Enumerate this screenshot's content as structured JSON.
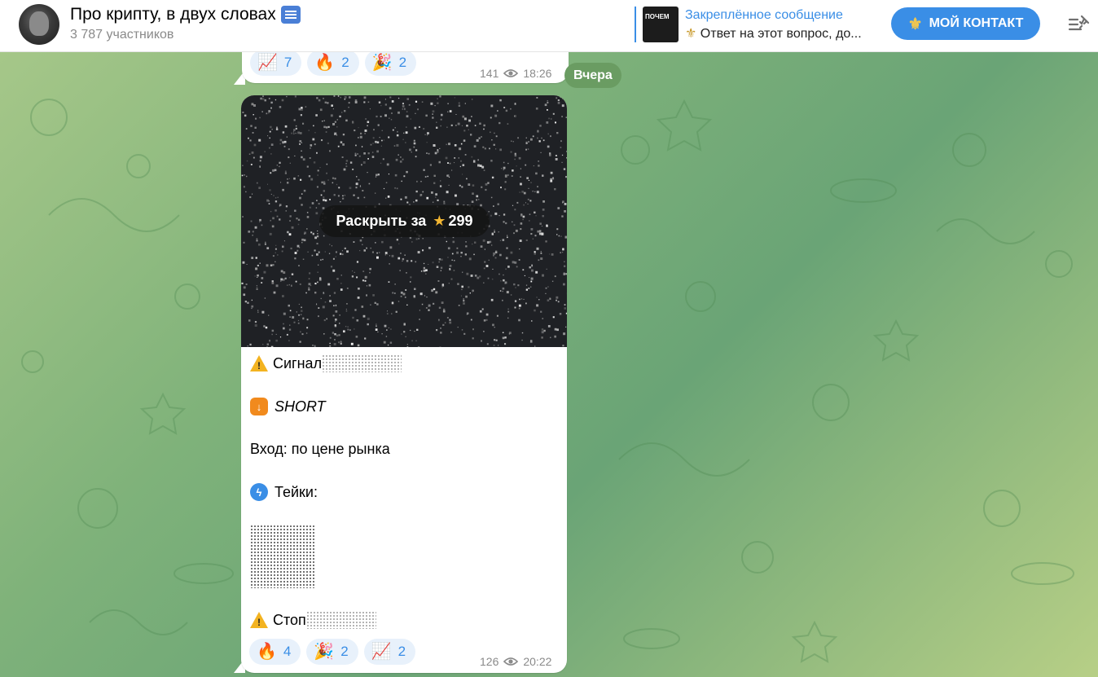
{
  "header": {
    "title": "Про крипту, в двух словах",
    "subscribers": "3 787 участников",
    "pinned": {
      "label": "Закреплённое сообщение",
      "preview": "Ответ на этот вопрос, до...",
      "thumb_text": "ПОЧЕМ"
    },
    "contact_button": "МОЙ КОНТАКТ"
  },
  "top_message": {
    "reactions": [
      {
        "emoji": "📈",
        "count": "7"
      },
      {
        "emoji": "🔥",
        "count": "2"
      },
      {
        "emoji": "🎉",
        "count": "2"
      }
    ],
    "views": "141",
    "time": "18:26"
  },
  "date_separator": "Вчера",
  "main_message": {
    "reveal_label": "Раскрыть за",
    "reveal_price": "299",
    "signal_label": "Сигнал",
    "direction": "SHORT",
    "entry": "Вход: по цене рынка",
    "takes_label": "Тейки:",
    "stop_label": "Стоп",
    "reactions": [
      {
        "emoji": "🔥",
        "count": "4"
      },
      {
        "emoji": "🎉",
        "count": "2"
      },
      {
        "emoji": "📈",
        "count": "2"
      }
    ],
    "views": "126",
    "time": "20:22"
  },
  "colors": {
    "accent": "#3a8ee6",
    "date_pill": "#6a9c62",
    "star": "#f2b632"
  }
}
